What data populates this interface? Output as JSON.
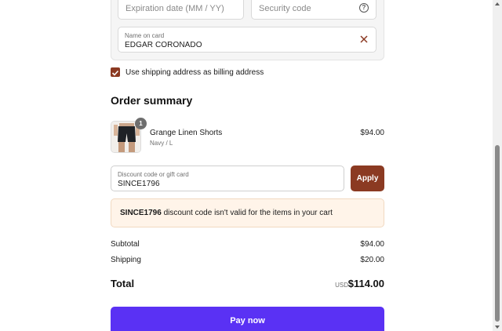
{
  "payment": {
    "expiration_placeholder": "Expiration date (MM / YY)",
    "security_placeholder": "Security code",
    "name_label": "Name on card",
    "name_value": "EDGAR CORONADO"
  },
  "billing": {
    "checkbox_checked": true,
    "checkbox_label": "Use shipping address as billing address"
  },
  "summary": {
    "title": "Order summary",
    "item": {
      "quantity": "1",
      "name": "Grange Linen Shorts",
      "variant": "Navy / L",
      "price": "$94.00"
    },
    "discount": {
      "label": "Discount code or gift card",
      "value": "SINCE1796",
      "apply_label": "Apply"
    },
    "alert": {
      "code": "SINCE1796",
      "message": " discount code isn't valid for the items in your cart"
    },
    "subtotal_label": "Subtotal",
    "subtotal_value": "$94.00",
    "shipping_label": "Shipping",
    "shipping_value": "$20.00",
    "total_label": "Total",
    "total_currency": "USD",
    "total_value": "$114.00"
  },
  "actions": {
    "pay_label": "Pay now"
  },
  "colors": {
    "accent": "#8b3a22",
    "pay_button": "#5a31f4",
    "alert_bg": "#fff4e9"
  }
}
